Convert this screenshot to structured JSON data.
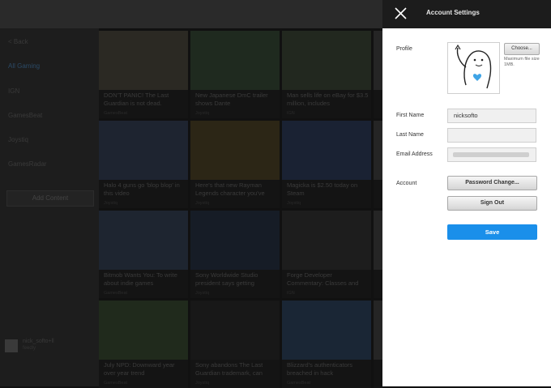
{
  "panel": {
    "title": "Account Settings",
    "profile_label": "Profile",
    "choose_label": "Choose...",
    "file_hint": "Maximum file size 1MB.",
    "first_name_label": "First Name",
    "first_name_value": "nicksofto",
    "last_name_label": "Last Name",
    "last_name_value": "",
    "email_label": "Email Address",
    "account_label": "Account",
    "password_change_label": "Password Change...",
    "sign_out_label": "Sign Out",
    "save_label": "Save",
    "save_color": "#1a8fea"
  },
  "sidebar": {
    "back": "< Back",
    "items": [
      "All Gaming",
      "IGN",
      "GamesBeat",
      "Joystiq",
      "GamesRadar"
    ],
    "add_content": "Add Content",
    "user_name": "nick_softo+ll",
    "user_sub": "feedly"
  },
  "grid": {
    "cards": [
      {
        "title": "DON'T PANIC! The Last Guardian is not dead.",
        "source": "GamesBeat"
      },
      {
        "title": "New Japanese DmC trailer shows Dante",
        "source": "Joystiq"
      },
      {
        "title": "Man sells life on eBay for $3.5 million, includes",
        "source": "IGN"
      },
      {
        "title": "Halo 4 guns go 'blop blop' in this video",
        "source": "Joystiq"
      },
      {
        "title": "Here's that new Rayman Legends character you've",
        "source": "Joystiq"
      },
      {
        "title": "Magicka is $2.50 today on Steam",
        "source": "Joystiq"
      },
      {
        "title": "Bitmob Wants You: To write about indie games",
        "source": "GamesBeat"
      },
      {
        "title": "Sony Worldwide Studio president says getting",
        "source": "Joystiq"
      },
      {
        "title": "Forge Developer Commentary: Classes and",
        "source": "IGN"
      },
      {
        "title": "July NPD: Downward year over year trend",
        "source": "GamesBeat"
      },
      {
        "title": "Sony abandons The Last Guardian trademark, can",
        "source": "Joystiq"
      },
      {
        "title": "Blizzard's authenticators breached in hack",
        "source": "GamesBeat"
      }
    ]
  }
}
